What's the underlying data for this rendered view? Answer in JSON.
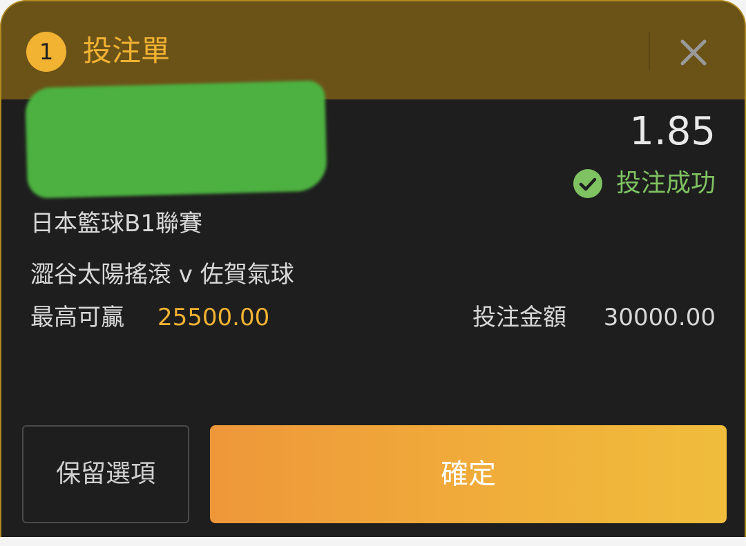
{
  "header": {
    "count": "1",
    "title": "投注單",
    "close_icon": "close-icon"
  },
  "bet": {
    "odds": "1.85",
    "status": "投注成功",
    "status_icon": "check-circle-icon",
    "league": "日本籃球B1聯賽",
    "match": "澀谷太陽搖滾 v 佐賀氣球",
    "max_win_label": "最高可贏",
    "max_win_value": "25500.00",
    "stake_label": "投注金額",
    "stake_value": "30000.00"
  },
  "actions": {
    "keep_label": "保留選項",
    "confirm_label": "確定"
  },
  "colors": {
    "accent": "#f2b232",
    "header_bg": "#6b5318",
    "success": "#7fc261",
    "panel_bg": "#1e1e1e",
    "redaction": "#4cb140"
  }
}
